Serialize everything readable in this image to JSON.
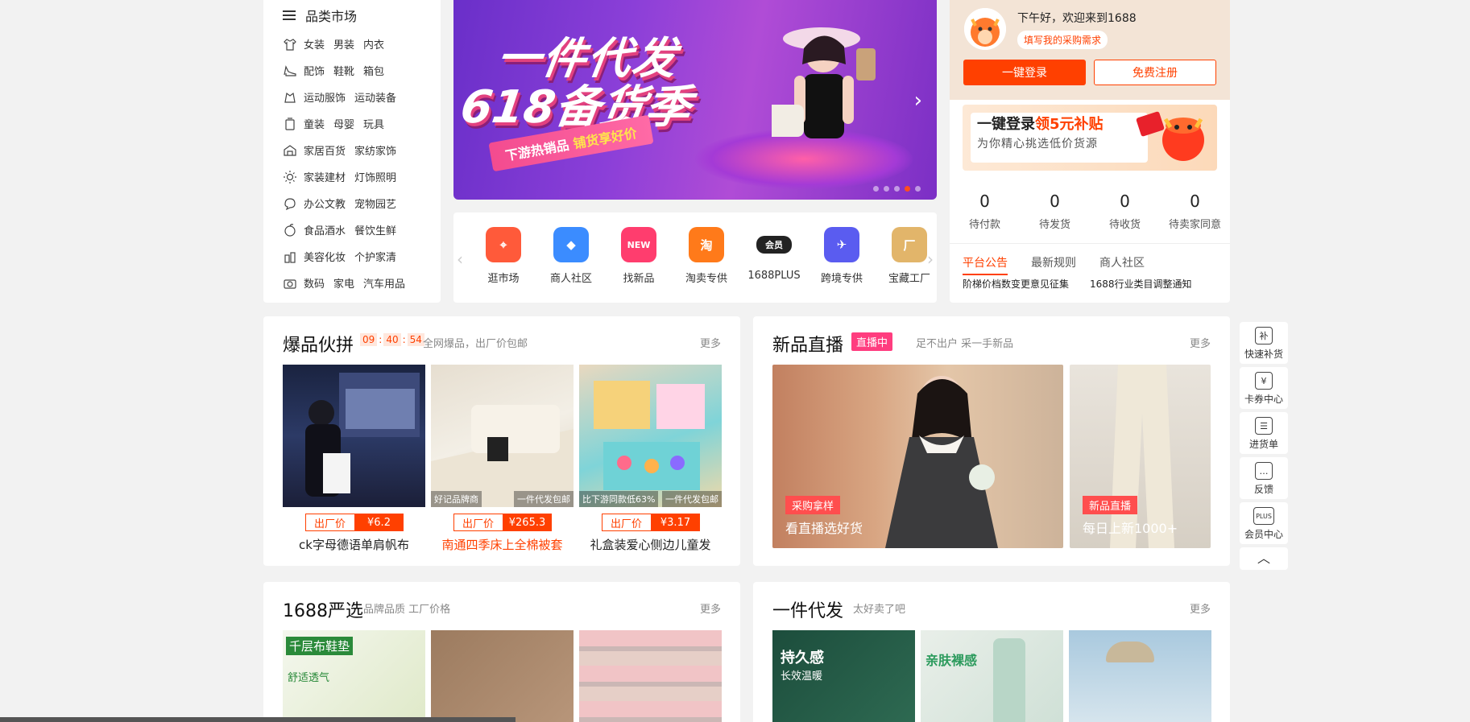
{
  "categories": {
    "header": "品类市场",
    "rows": [
      {
        "icon": "shirt-icon",
        "links": [
          "女装",
          "男装",
          "内衣"
        ]
      },
      {
        "icon": "heel-icon",
        "links": [
          "配饰",
          "鞋靴",
          "箱包"
        ]
      },
      {
        "icon": "sport-icon",
        "links": [
          "运动服饰",
          "运动装备"
        ]
      },
      {
        "icon": "kids-icon",
        "links": [
          "童装",
          "母婴",
          "玩具"
        ]
      },
      {
        "icon": "home-icon",
        "links": [
          "家居百货",
          "家纺家饰"
        ]
      },
      {
        "icon": "bulb-icon",
        "links": [
          "家装建材",
          "灯饰照明"
        ]
      },
      {
        "icon": "office-icon",
        "links": [
          "办公文教",
          "宠物园艺"
        ]
      },
      {
        "icon": "food-icon",
        "links": [
          "食品酒水",
          "餐饮生鲜"
        ]
      },
      {
        "icon": "cosmetic-icon",
        "links": [
          "美容化妆",
          "个护家清"
        ]
      },
      {
        "icon": "camera-icon",
        "links": [
          "数码",
          "家电",
          "汽车用品"
        ]
      }
    ]
  },
  "banner": {
    "line1": "一件代发",
    "line2": "618备货季",
    "ribbon_a": "下游热销品",
    "ribbon_b": "铺货享好价"
  },
  "shortcuts": [
    {
      "label": "逛市场",
      "icon": "map-pin-icon",
      "color": "#ff5a3a",
      "glyph": "⌖"
    },
    {
      "label": "商人社区",
      "icon": "community-icon",
      "color": "#3b8cff",
      "glyph": "◆"
    },
    {
      "label": "找新品",
      "icon": "new-gift-icon",
      "color": "#ff3d6e",
      "glyph": "NEW"
    },
    {
      "label": "淘卖专供",
      "icon": "taobao-icon",
      "color": "#ff7a1a",
      "glyph": "淘"
    },
    {
      "label": "1688PLUS",
      "icon": "member-icon",
      "color": "#222222",
      "glyph": "会员"
    },
    {
      "label": "跨境专供",
      "icon": "plane-icon",
      "color": "#5a5cf0",
      "glyph": "✈"
    },
    {
      "label": "宝藏工厂",
      "icon": "factory-badge-icon",
      "color": "#e2b56a",
      "glyph": "厂"
    }
  ],
  "user": {
    "greeting": "下午好，欢迎来到1688",
    "request_pill": "填写我的采购需求",
    "login_label": "一键登录",
    "register_label": "免费注册",
    "promo_a": "一键登录",
    "promo_b": "领5元补贴",
    "promo_line2": "为你精心挑选低价货源",
    "stats": [
      {
        "num": "0",
        "label": "待付款"
      },
      {
        "num": "0",
        "label": "待发货"
      },
      {
        "num": "0",
        "label": "待收货"
      },
      {
        "num": "0",
        "label": "待卖家同意"
      }
    ],
    "tabs": [
      "平台公告",
      "最新规则",
      "商人社区"
    ],
    "notices": [
      "阶梯价档数变更意见征集",
      "1688行业类目调整通知"
    ]
  },
  "hot": {
    "title": "爆品伙拼",
    "timer": [
      "09",
      "40",
      "54"
    ],
    "subtitle": "全网爆品，出厂价包邮",
    "more": "更多",
    "price_label": "出厂价",
    "products": [
      {
        "name": "ck字母德语单肩帆布",
        "price": "¥6.2",
        "tag": "",
        "highlight": false
      },
      {
        "name": "南通四季床上全棉被套",
        "price": "¥265.3",
        "tag": "好记品牌商",
        "tag2": "一件代发包邮",
        "highlight": true
      },
      {
        "name": "礼盒装爱心侧边儿童发",
        "price": "¥3.17",
        "tag": "比下游同款低63%",
        "tag2": "一件代发包邮",
        "highlight": false
      }
    ]
  },
  "live": {
    "title": "新品直播",
    "badge": "直播中",
    "subtitle": "足不出户 采一手新品",
    "more": "更多",
    "items": [
      {
        "pill": "采购拿样",
        "caption": "看直播选好货"
      },
      {
        "pill": "新品直播",
        "caption": "每日上新1000+"
      }
    ]
  },
  "select": {
    "title": "1688严选",
    "subtitle": "品牌品质 工厂价格",
    "more": "更多",
    "img1_text": "千层布鞋垫",
    "img1_sub": "舒适透气"
  },
  "dropship": {
    "title": "一件代发",
    "subtitle": "太好卖了吧",
    "more": "更多",
    "img1_text": "持久感",
    "img1_sub": "长效温暖",
    "img2_text": "亲肤裸感"
  },
  "toolbar": [
    "快速补货",
    "卡券中心",
    "进货单",
    "反馈",
    "会员中心"
  ],
  "toolbar_glyphs": [
    "补",
    "¥",
    "☰",
    "…",
    "PLUS"
  ],
  "colors": {
    "accent": "#ff4000",
    "live": "#ff3d7f"
  }
}
